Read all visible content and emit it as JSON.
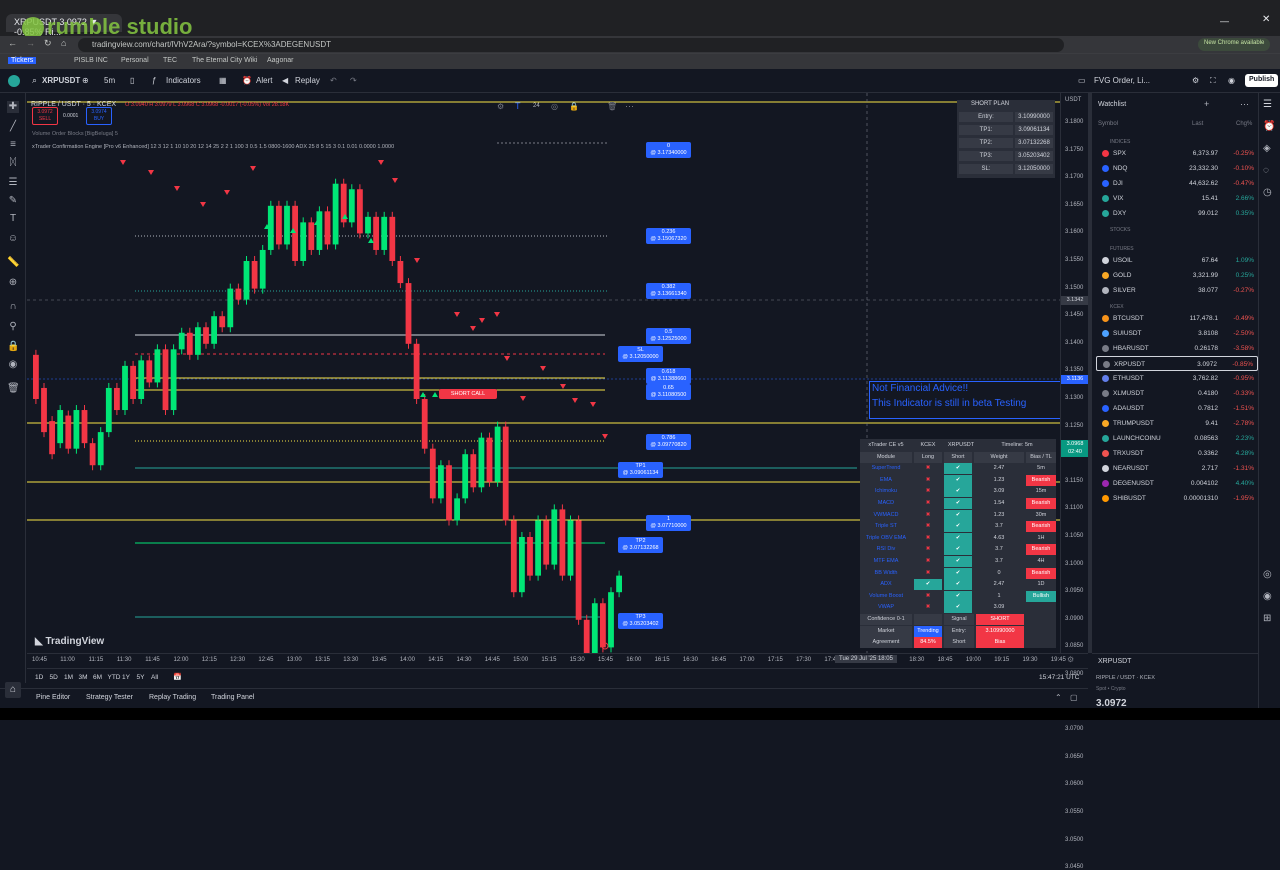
{
  "browser": {
    "tab_title": "XRPUSDT 3.0972 ▼ -0.85% Ri...",
    "url": "tradingview.com/chart/lVhV2Ara/?symbol=KCEX%3ADEGENUSDT",
    "chrome_update": "New Chrome available",
    "bookmarks": [
      "Tickers",
      "PISLB INC",
      "Personal",
      "TEC",
      "The Eternal City Wiki",
      "Aagonar"
    ],
    "watermark": "rumble studio"
  },
  "toolbar": {
    "symbol": "XRPUSDT",
    "interval": "5m",
    "indicators": "Indicators",
    "alert": "Alert",
    "replay": "Replay",
    "layout_name": "FVG Order, Li...",
    "publish": "Publish"
  },
  "chart_header": {
    "title": "RIPPLE / USDT · 5 · KCEX",
    "ohlc": "O 3.0940  H 3.0979  L 3.0968  C 3.0968  -0.0017 (-0.05%)  Vol 28.18K",
    "sell_price": "3.0972",
    "sell_label": "SELL",
    "spread": "0.0001",
    "buy_price": "3.0974",
    "buy_label": "BUY",
    "indicator1": "Volume Order Blocks [BigBeluga] 5",
    "indicator2": "xTrader Confirmation Engine [Pro v6 Enhanced] 12 3 12 1 10 10 20 12 14 25 2 2 1 100 3 0.5 1.5 0800-1600 ADX 25 8 5 15 3 0.1 0.01  0.0000  1.0000"
  },
  "price_axis": {
    "currency": "USDT",
    "labels": [
      "3.1800",
      "3.1750",
      "3.1700",
      "3.1650",
      "3.1600",
      "3.1550",
      "3.1500",
      "3.1450",
      "3.1400",
      "3.1350",
      "3.1300",
      "3.1250",
      "3.1200",
      "3.1150",
      "3.1100",
      "3.1050",
      "3.1000",
      "3.0950",
      "3.0900",
      "3.0850",
      "3.0800",
      "3.0750",
      "3.0700",
      "3.0650",
      "3.0600",
      "3.0550",
      "3.0500",
      "3.0450"
    ],
    "crosshair_price": "3.1342",
    "current_price": "3.0968",
    "current_sub": "02:40",
    "marker_price": "3.1136"
  },
  "time_axis": {
    "labels": [
      "10:45",
      "11:00",
      "11:15",
      "11:30",
      "11:45",
      "12:00",
      "12:15",
      "12:30",
      "12:45",
      "13:00",
      "13:15",
      "13:30",
      "13:45",
      "14:00",
      "14:15",
      "14:30",
      "14:45",
      "15:00",
      "15:15",
      "15:30",
      "15:45",
      "16:00",
      "16:15",
      "16:30",
      "16:45",
      "17:00",
      "17:15",
      "17:30",
      "17:45",
      "18:00",
      "18:15",
      "18:30",
      "18:45",
      "19:00",
      "19:15",
      "19:30",
      "19:45"
    ],
    "cursor": "Tue 29 Jul '25  18:05"
  },
  "fib_levels": [
    {
      "ratio": "0",
      "price": "3.17340000"
    },
    {
      "ratio": "0.236",
      "price": "3.15067320"
    },
    {
      "ratio": "0.382",
      "price": "3.13661340"
    },
    {
      "ratio": "0.5",
      "price": "3.12525000"
    },
    {
      "ratio": "SL",
      "price": "3.12050000"
    },
    {
      "ratio": "0.618",
      "price": "3.11388660"
    },
    {
      "ratio": "0.65",
      "price": "3.11080500"
    },
    {
      "ratio": "0.786",
      "price": "3.09770820"
    },
    {
      "ratio": "TP1",
      "price": "3.09061134"
    },
    {
      "ratio": "1",
      "price": "3.07710000"
    },
    {
      "ratio": "TP2",
      "price": "3.07132268"
    },
    {
      "ratio": "TP3",
      "price": "3.05203402"
    }
  ],
  "short_call": "SHORT CALL",
  "short_plan": {
    "title": "SHORT PLAN",
    "rows": [
      {
        "k": "Entry:",
        "v": "3.10990000"
      },
      {
        "k": "TP1:",
        "v": "3.09061134"
      },
      {
        "k": "TP2:",
        "v": "3.07132268"
      },
      {
        "k": "TP3:",
        "v": "3.05203402"
      },
      {
        "k": "SL:",
        "v": "3.12050000"
      }
    ]
  },
  "notice": {
    "line1": "Not Financial Advice!!",
    "line2": "This Indicator is still in beta Testing"
  },
  "xtrader": {
    "header": [
      "xTrader CE v5",
      "KCEX",
      "XRPUSDT",
      "Timeline: 5m"
    ],
    "columns": [
      "Module",
      "Long",
      "Short",
      "Weight",
      "Bias / TL"
    ],
    "rows": [
      {
        "module": "SuperTrend",
        "long": "✖",
        "short": "✔",
        "weight": "2.47",
        "bias": "5m"
      },
      {
        "module": "EMA",
        "long": "✖",
        "short": "✔",
        "weight": "1.23",
        "bias": "Bearish"
      },
      {
        "module": "Ichimoku",
        "long": "✖",
        "short": "✔",
        "weight": "3.09",
        "bias": "15m"
      },
      {
        "module": "MACD",
        "long": "✖",
        "short": "✔",
        "weight": "1.54",
        "bias": "Bearish"
      },
      {
        "module": "VWMACD",
        "long": "✖",
        "short": "✔",
        "weight": "1.23",
        "bias": "30m"
      },
      {
        "module": "Triple ST",
        "long": "✖",
        "short": "✔",
        "weight": "3.7",
        "bias": "Bearish"
      },
      {
        "module": "Triple OBV EMA",
        "long": "✖",
        "short": "✔",
        "weight": "4.63",
        "bias": "1H"
      },
      {
        "module": "RSI Div",
        "long": "✖",
        "short": "✔",
        "weight": "3.7",
        "bias": "Bearish"
      },
      {
        "module": "MTF EMA",
        "long": "✖",
        "short": "✔",
        "weight": "3.7",
        "bias": "4H"
      },
      {
        "module": "BB Width",
        "long": "✖",
        "short": "✔",
        "weight": "0",
        "bias": "Bearish"
      },
      {
        "module": "ADX",
        "long": "✔",
        "short": "✔",
        "weight": "2.47",
        "bias": "1D"
      },
      {
        "module": "Volume Boost",
        "long": "✖",
        "short": "✔",
        "weight": "1",
        "bias": "Bullish"
      },
      {
        "module": "VWAP",
        "long": "✖",
        "short": "✔",
        "weight": "3.09",
        "bias": ""
      }
    ],
    "footer": [
      [
        "Confidence 0-1",
        "",
        "Signal",
        "SHORT"
      ],
      [
        "Market",
        "Trending",
        "Entry:",
        "3.10990000"
      ],
      [
        "Agreement",
        "84.5%",
        "Short",
        "Bias"
      ]
    ]
  },
  "watchlist": {
    "title": "Watchlist",
    "cols": [
      "Symbol",
      "Last",
      "Chg%"
    ],
    "sections": [
      {
        "name": "INDICES",
        "items": [
          {
            "sym": "SPX",
            "last": "6,373.97",
            "chg": "-0.25%",
            "dir": "dn",
            "dot": "#f23645"
          },
          {
            "sym": "NDQ",
            "last": "23,332.30",
            "chg": "-0.10%",
            "dir": "dn",
            "dot": "#2962ff"
          },
          {
            "sym": "DJI",
            "last": "44,632.62",
            "chg": "-0.47%",
            "dir": "dn",
            "dot": "#2962ff"
          },
          {
            "sym": "VIX",
            "last": "15.41",
            "chg": "2.66%",
            "dir": "up",
            "dot": "#26a69a"
          },
          {
            "sym": "DXY",
            "last": "99.012",
            "chg": "0.35%",
            "dir": "up",
            "dot": "#26a69a"
          }
        ]
      },
      {
        "name": "STOCKS",
        "items": []
      },
      {
        "name": "FUTURES",
        "items": [
          {
            "sym": "USOIL",
            "last": "67.64",
            "chg": "1.09%",
            "dir": "up",
            "dot": "#d1d4dc"
          },
          {
            "sym": "GOLD",
            "last": "3,321.99",
            "chg": "0.25%",
            "dir": "up",
            "dot": "#f9a825"
          },
          {
            "sym": "SILVER",
            "last": "38.077",
            "chg": "-0.27%",
            "dir": "dn",
            "dot": "#b2b5be"
          }
        ]
      },
      {
        "name": "KCEX",
        "items": [
          {
            "sym": "BTCUSDT",
            "last": "117,478.1",
            "chg": "-0.49%",
            "dir": "dn",
            "dot": "#f7931a"
          },
          {
            "sym": "SUIUSDT",
            "last": "3.8108",
            "chg": "-2.50%",
            "dir": "dn",
            "dot": "#4da2ff"
          },
          {
            "sym": "HBARUSDT",
            "last": "0.26178",
            "chg": "-3.58%",
            "dir": "dn",
            "dot": "#787b86"
          },
          {
            "sym": "XRPUSDT",
            "last": "3.0972",
            "chg": "-0.85%",
            "dir": "dn",
            "dot": "#787b86"
          },
          {
            "sym": "ETHUSDT",
            "last": "3,762.82",
            "chg": "-0.95%",
            "dir": "dn",
            "dot": "#627eea"
          },
          {
            "sym": "XLMUSDT",
            "last": "0.4180",
            "chg": "-0.33%",
            "dir": "dn",
            "dot": "#787b86"
          },
          {
            "sym": "ADAUSDT",
            "last": "0.7812",
            "chg": "-1.51%",
            "dir": "dn",
            "dot": "#2962ff"
          },
          {
            "sym": "TRUMPUSDT",
            "last": "9.41",
            "chg": "-2.78%",
            "dir": "dn",
            "dot": "#f9a825"
          },
          {
            "sym": "LAUNCHCOINU",
            "last": "0.08563",
            "chg": "2.23%",
            "dir": "up",
            "dot": "#26a69a"
          },
          {
            "sym": "TRXUSDT",
            "last": "0.3362",
            "chg": "4.28%",
            "dir": "up",
            "dot": "#ef5350"
          },
          {
            "sym": "NEARUSDT",
            "last": "2.717",
            "chg": "-1.31%",
            "dir": "dn",
            "dot": "#d1d4dc"
          },
          {
            "sym": "DEGENUSDT",
            "last": "0.004102",
            "chg": "4.40%",
            "dir": "up",
            "dot": "#9c27b0"
          },
          {
            "sym": "SHIBUSDT",
            "last": "0.00001310",
            "chg": "-1.95%",
            "dir": "dn",
            "dot": "#ff9800"
          }
        ]
      }
    ],
    "detail_symbol": "XRPUSDT",
    "detail_name": "RIPPLE / USDT · KCEX",
    "detail_type": "Spot • Crypto",
    "detail_price": "3.0972"
  },
  "range_bar": [
    "1D",
    "5D",
    "1M",
    "3M",
    "6M",
    "YTD",
    "1Y",
    "5Y",
    "All"
  ],
  "clock": "15:47:21 UTC",
  "bottom_tabs": [
    "Pine Editor",
    "Strategy Tester",
    "Replay Trading",
    "Trading Panel"
  ],
  "logo": "TradingView",
  "colors": {
    "bg": "#131722",
    "up": "#26a69a",
    "down": "#ef5350",
    "bull_candle": "#00e676",
    "bear_candle": "#f23645",
    "fib_blue": "#2962ff",
    "yellow": "#f9e547"
  }
}
